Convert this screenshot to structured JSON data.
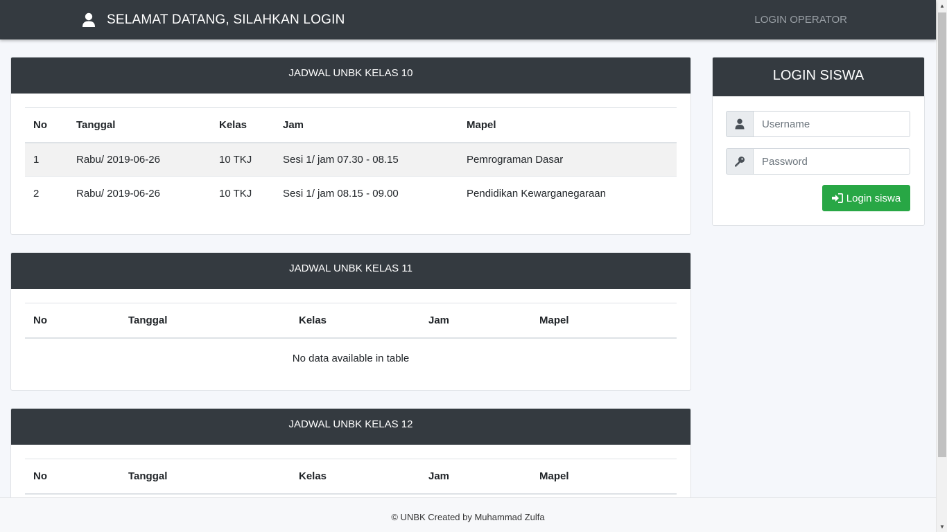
{
  "navbar": {
    "title": "SELAMAT DATANG, SILAHKAN LOGIN",
    "operator_link": "LOGIN OPERATOR",
    "title_icon": "user-icon"
  },
  "schedules": [
    {
      "title": "JADWAL UNBK KELAS 10",
      "columns": [
        "No",
        "Tanggal",
        "Kelas",
        "Jam",
        "Mapel"
      ],
      "rows": [
        [
          "1",
          "Rabu/ 2019-06-26",
          "10 TKJ",
          "Sesi 1/ jam 07.30 - 08.15",
          "Pemrograman Dasar"
        ],
        [
          "2",
          "Rabu/ 2019-06-26",
          "10 TKJ",
          "Sesi 1/ jam 08.15 - 09.00",
          "Pendidikan Kewarganegaraan"
        ]
      ]
    },
    {
      "title": "JADWAL UNBK KELAS 11",
      "columns": [
        "No",
        "Tanggal",
        "Kelas",
        "Jam",
        "Mapel"
      ],
      "rows": [],
      "empty_text": "No data available in table"
    },
    {
      "title": "JADWAL UNBK KELAS 12",
      "columns": [
        "No",
        "Tanggal",
        "Kelas",
        "Jam",
        "Mapel"
      ],
      "rows": []
    }
  ],
  "login": {
    "title": "LOGIN SISWA",
    "username_placeholder": "Username",
    "password_placeholder": "Password",
    "button_label": "Login siswa",
    "username_icon": "user-icon",
    "password_icon": "key-icon",
    "button_icon": "sign-in-icon",
    "button_color": "#28a745"
  },
  "footer": {
    "text": "© UNBK Created by Muhammad Zulfa"
  },
  "colors": {
    "navbar": "#343a40",
    "card_header": "#343a40",
    "background": "#f5f7fb"
  }
}
